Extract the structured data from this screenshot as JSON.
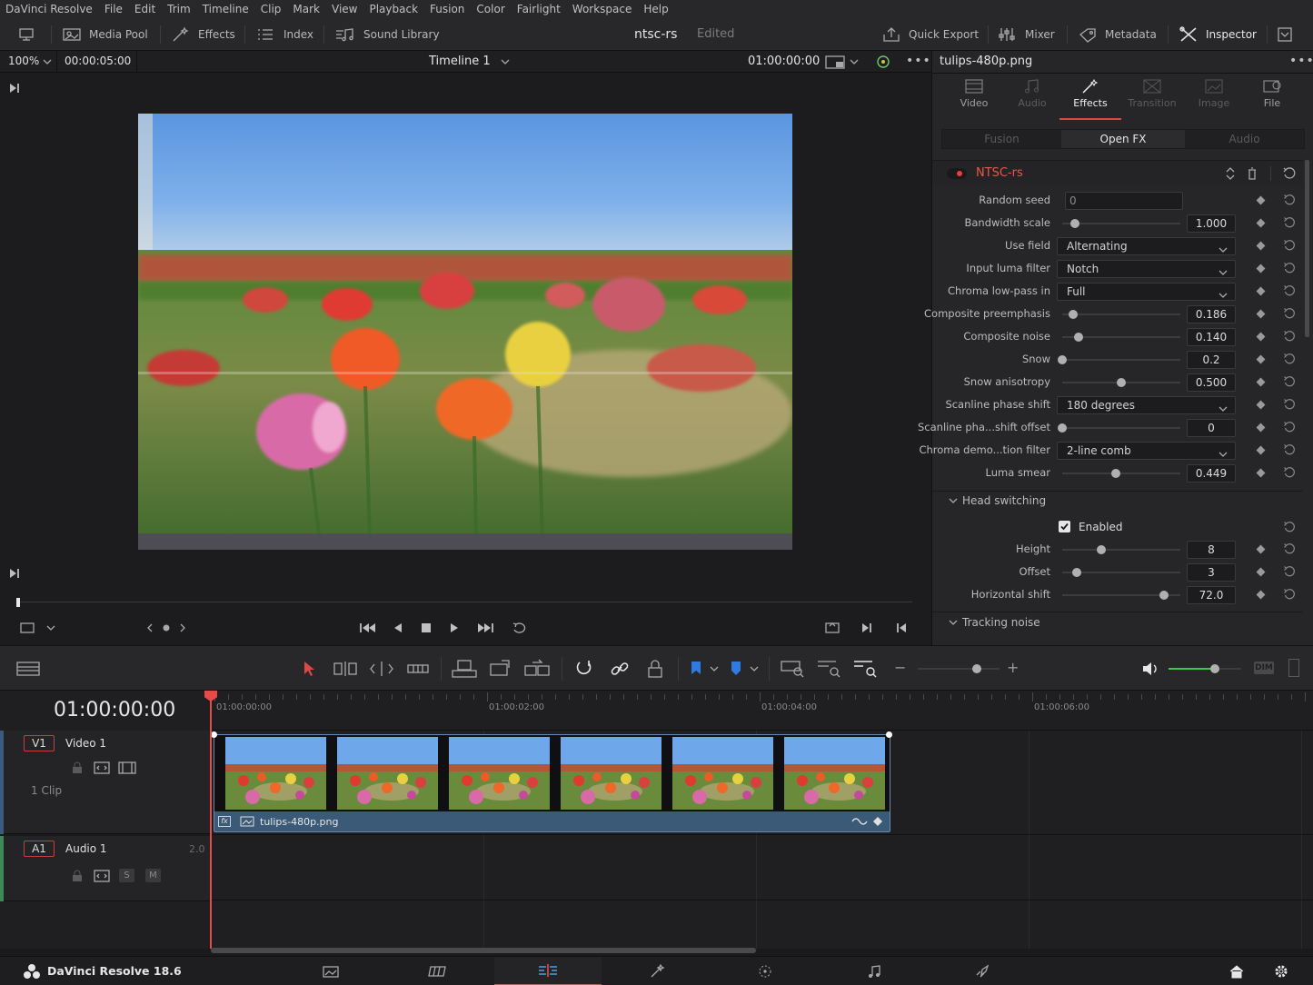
{
  "menu": [
    "DaVinci Resolve",
    "File",
    "Edit",
    "Trim",
    "Timeline",
    "Clip",
    "Mark",
    "View",
    "Playback",
    "Fusion",
    "Color",
    "Fairlight",
    "Workspace",
    "Help"
  ],
  "toolbar": {
    "media_pool": "Media Pool",
    "effects": "Effects",
    "index": "Index",
    "sound_library": "Sound Library",
    "project_title": "ntsc-rs",
    "project_status": "Edited",
    "quick_export": "Quick Export",
    "mixer": "Mixer",
    "metadata": "Metadata",
    "inspector": "Inspector"
  },
  "viewer": {
    "zoom": "100%",
    "duration": "00:00:05:00",
    "timeline_name": "Timeline 1",
    "timecode": "01:00:00:00"
  },
  "inspector": {
    "clip_name": "tulips-480p.png",
    "tabs": [
      "Video",
      "Audio",
      "Effects",
      "Transition",
      "Image",
      "File"
    ],
    "active_tab": "Effects",
    "subtabs": [
      "Fusion",
      "Open FX",
      "Audio"
    ],
    "active_subtab": "Open FX",
    "effect_name": "NTSC-rs",
    "params": [
      {
        "label": "Random seed",
        "type": "text",
        "value": "0"
      },
      {
        "label": "Bandwidth scale",
        "type": "slider",
        "value": "1.000",
        "pos": 0.11
      },
      {
        "label": "Use field",
        "type": "dropdown",
        "value": "Alternating"
      },
      {
        "label": "Input luma filter",
        "type": "dropdown",
        "value": "Notch"
      },
      {
        "label": "Chroma low-pass in",
        "type": "dropdown",
        "value": "Full"
      },
      {
        "label": "Composite preemphasis",
        "type": "slider",
        "value": "0.186",
        "pos": 0.09
      },
      {
        "label": "Composite noise",
        "type": "slider",
        "value": "0.140",
        "pos": 0.14
      },
      {
        "label": "Snow",
        "type": "slider",
        "value": "0.2",
        "pos": 0.0
      },
      {
        "label": "Snow anisotropy",
        "type": "slider",
        "value": "0.500",
        "pos": 0.5
      },
      {
        "label": "Scanline phase shift",
        "type": "dropdown",
        "value": "180 degrees"
      },
      {
        "label": "Scanline pha...shift offset",
        "type": "slider",
        "value": "0",
        "pos": 0.0
      },
      {
        "label": "Chroma demo...tion filter",
        "type": "dropdown",
        "value": "2-line comb"
      },
      {
        "label": "Luma smear",
        "type": "slider",
        "value": "0.449",
        "pos": 0.45
      }
    ],
    "head_switching": {
      "title": "Head switching",
      "enabled_label": "Enabled",
      "enabled": true,
      "params": [
        {
          "label": "Height",
          "value": "8",
          "pos": 0.33
        },
        {
          "label": "Offset",
          "value": "3",
          "pos": 0.12
        },
        {
          "label": "Horizontal shift",
          "value": "72.0",
          "pos": 0.86
        }
      ]
    },
    "tracking_noise": "Tracking noise"
  },
  "timeline": {
    "timecode": "01:00:00:00",
    "ruler": [
      "01:00:00:00",
      "01:00:02:00",
      "01:00:04:00",
      "01:00:06:00"
    ],
    "video_track": {
      "badge": "V1",
      "name": "Video 1",
      "clips": "1 Clip",
      "clip_name": "tulips-480p.png"
    },
    "audio_track": {
      "badge": "A1",
      "name": "Audio 1",
      "level": "2.0",
      "solo": "S",
      "mute": "M"
    }
  },
  "bottom": {
    "app": "DaVinci Resolve 18.6"
  },
  "colors": {
    "accent_red": "#e04040",
    "playhead": "#e84a4a",
    "clip_bar": "#3b5a78",
    "active_tab": "#e0e0e0"
  }
}
